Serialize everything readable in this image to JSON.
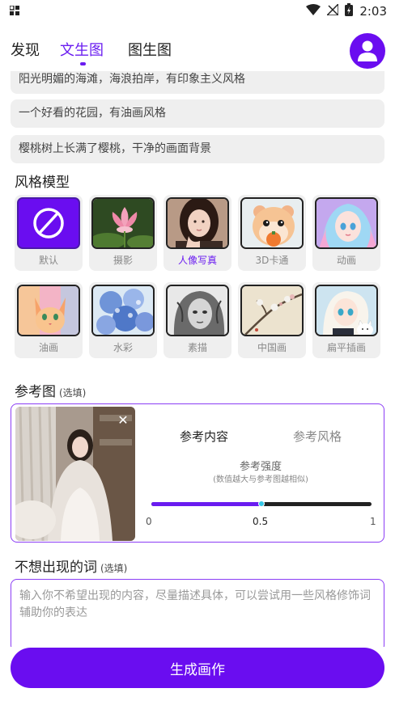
{
  "status": {
    "time": "2:03"
  },
  "tabs": [
    {
      "label": "发现"
    },
    {
      "label": "文生图"
    },
    {
      "label": "图生图"
    }
  ],
  "accent_color": "#6a1cf0",
  "prompts": [
    "阳光明媚的海滩，海浪拍岸，有印象主义风格",
    "一个好看的花园，有油画风格",
    "樱桃树上长满了樱桃，干净的画面背景"
  ],
  "style_section": {
    "title": "风格模型"
  },
  "styles": [
    {
      "label": "默认",
      "icon": "prohibit-icon"
    },
    {
      "label": "摄影",
      "icon": "lotus-photo"
    },
    {
      "label": "人像写真",
      "icon": "portrait-photo",
      "selected": true
    },
    {
      "label": "3D卡通",
      "icon": "hamster-3d"
    },
    {
      "label": "动画",
      "icon": "anime-girl"
    },
    {
      "label": "油画",
      "icon": "cat-oil-painting"
    },
    {
      "label": "水彩",
      "icon": "hydrangea-watercolor"
    },
    {
      "label": "素描",
      "icon": "sketch-portrait"
    },
    {
      "label": "中国画",
      "icon": "chinese-painting"
    },
    {
      "label": "扁平插画",
      "icon": "flat-illustration"
    }
  ],
  "reference": {
    "title": "参考图",
    "optional": "(选填)",
    "tab_content": "参考内容",
    "tab_style": "参考风格",
    "strength_label": "参考强度",
    "strength_hint": "(数值越大与参考图越相似)",
    "value": 0.5,
    "min_label": "0",
    "mid_label": "0.5",
    "max_label": "1"
  },
  "negative": {
    "title": "不想出现的词",
    "optional": "(选填)",
    "placeholder": "输入你不希望出现的内容，尽量描述具体，可以尝试用一些风格修饰词辅助你的表达"
  },
  "generate": {
    "label": "生成画作"
  }
}
